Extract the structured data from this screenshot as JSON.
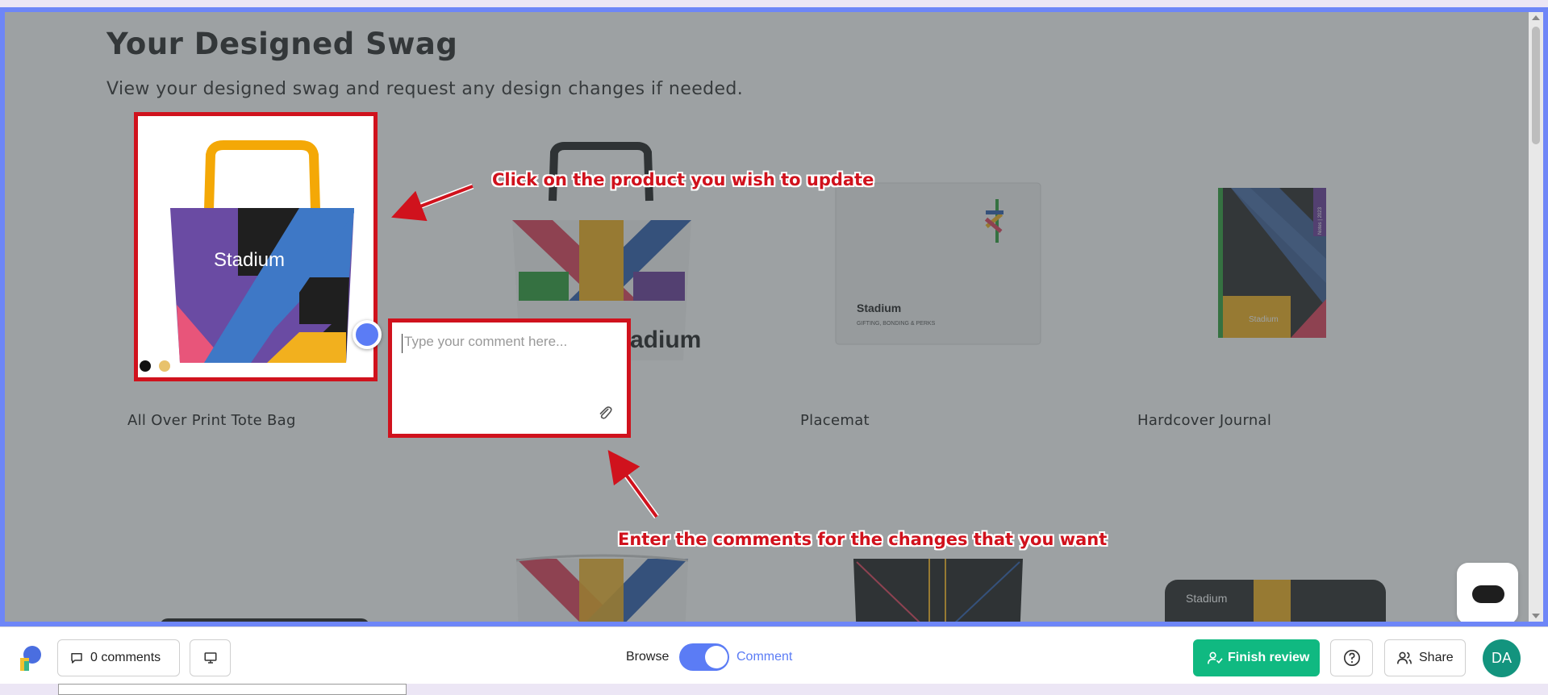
{
  "page": {
    "title": "Your Designed Swag",
    "subtitle": "View your designed swag and request any design changes if needed.",
    "products": [
      {
        "name": "All Over Print Tote Bag"
      },
      {
        "name": ""
      },
      {
        "name": "Placemat"
      },
      {
        "name": "Hardcover Journal"
      }
    ],
    "tote_brand": "Stadium",
    "tote2_brand": "Stadium",
    "placemat_brand": "Stadium",
    "placemat_tagline": "GIFTING, BONDING & PERKS",
    "journal_brand": "Stadium",
    "journal_spine": "Notes | 2023",
    "laptop_brand": "Stadium",
    "color_dots": [
      "#111111",
      "#e8c26c"
    ]
  },
  "annotations": {
    "click_product": "Click on the product you wish to update",
    "enter_comments": "Enter the comments for the changes that you want"
  },
  "comment": {
    "placeholder": "Type your comment here..."
  },
  "toolbar": {
    "comments_count": "0 comments",
    "browse_label": "Browse",
    "comment_label": "Comment",
    "finish_review_label": "Finish review",
    "share_label": "Share",
    "avatar_initials": "DA",
    "accent": "#5b7cf5",
    "finish_color": "#10b981"
  }
}
